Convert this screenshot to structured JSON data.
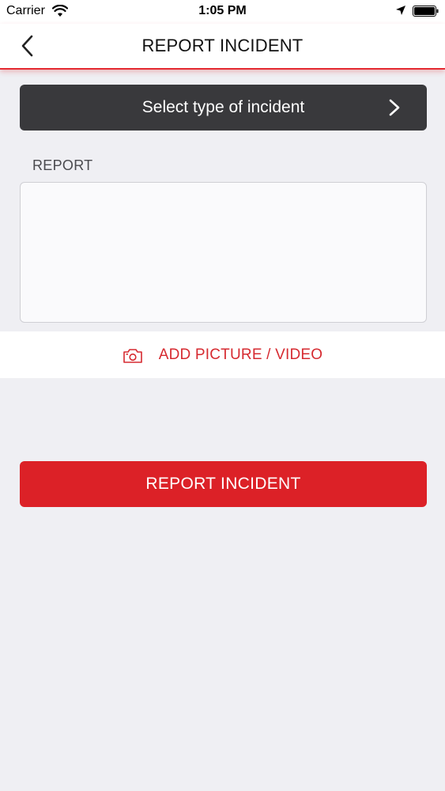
{
  "status_bar": {
    "carrier": "Carrier",
    "time": "1:05 PM",
    "icons": [
      "wifi-icon",
      "location-arrow-icon",
      "battery-icon"
    ]
  },
  "nav": {
    "title": "REPORT INCIDENT",
    "back_icon": "chevron-left-icon"
  },
  "incident_type": {
    "label": "Select type of incident",
    "icon": "chevron-right-icon"
  },
  "report": {
    "label": "REPORT",
    "value": ""
  },
  "media": {
    "label": "ADD PICTURE / VIDEO",
    "icon": "camera-icon"
  },
  "submit": {
    "label": "REPORT INCIDENT"
  },
  "colors": {
    "accent_red": "#dc2127",
    "select_bg": "#39393c",
    "page_bg": "#efeff3"
  }
}
